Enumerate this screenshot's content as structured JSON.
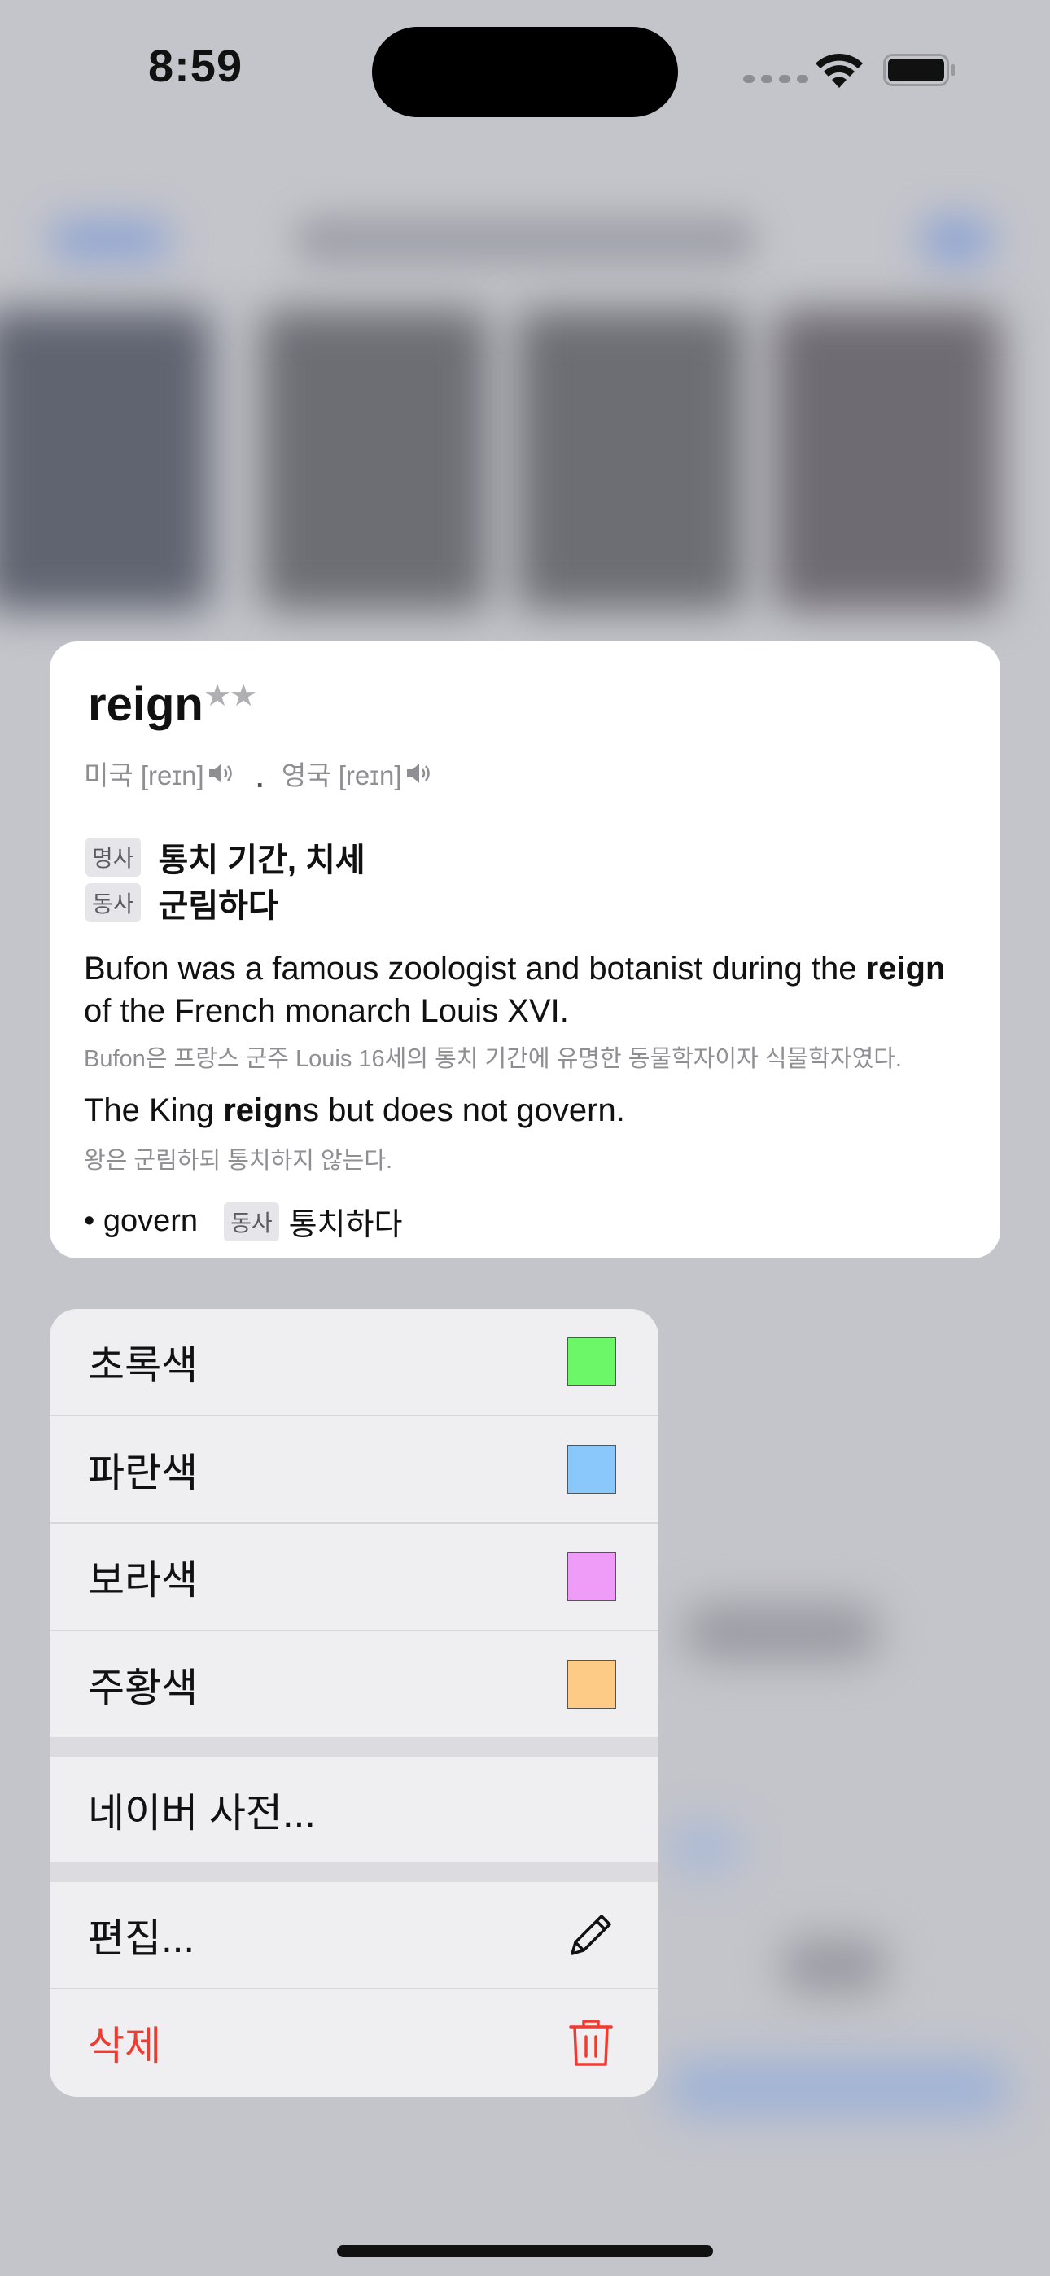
{
  "status_bar": {
    "time": "8:59"
  },
  "card": {
    "word": "reign",
    "stars": "★★",
    "pron_us": "미국 [reɪn]",
    "pron_sep": ".",
    "pron_uk": "영국 [reɪn]",
    "meanings": [
      {
        "pos": "명사",
        "text": "통치 기간, 치세"
      },
      {
        "pos": "동사",
        "text": "군림하다"
      }
    ],
    "examples": [
      {
        "en_pre": "Bufon was a famous zoologist and botanist during the ",
        "en_bold": "reign",
        "en_post": " of the French monarch Louis XVI.",
        "ko": "Bufon은 프랑스 군주 Louis 16세의 통치 기간에 유명한 동물학자이자 식물학자였다."
      },
      {
        "en_pre": "The King ",
        "en_bold": "reign",
        "en_post": "s but does not govern.",
        "ko": "왕은 군림하되 통치하지 않는다."
      }
    ],
    "related": {
      "word": "• govern",
      "pos": "동사",
      "meaning": "통치하다"
    }
  },
  "menu": {
    "colors": [
      {
        "label": "초록색",
        "swatch": "#6cf768"
      },
      {
        "label": "파란색",
        "swatch": "#8ac8fb"
      },
      {
        "label": "보라색",
        "swatch": "#ee9cf7"
      },
      {
        "label": "주황색",
        "swatch": "#fdcb86"
      }
    ],
    "naver": "네이버 사전...",
    "edit": "편집...",
    "delete": "삭제"
  },
  "icons": {
    "speaker": "speaker-icon",
    "pencil": "pencil-icon",
    "trash": "trash-icon",
    "wifi": "wifi-icon",
    "battery": "battery-icon",
    "delete_color": "#f23b30"
  }
}
